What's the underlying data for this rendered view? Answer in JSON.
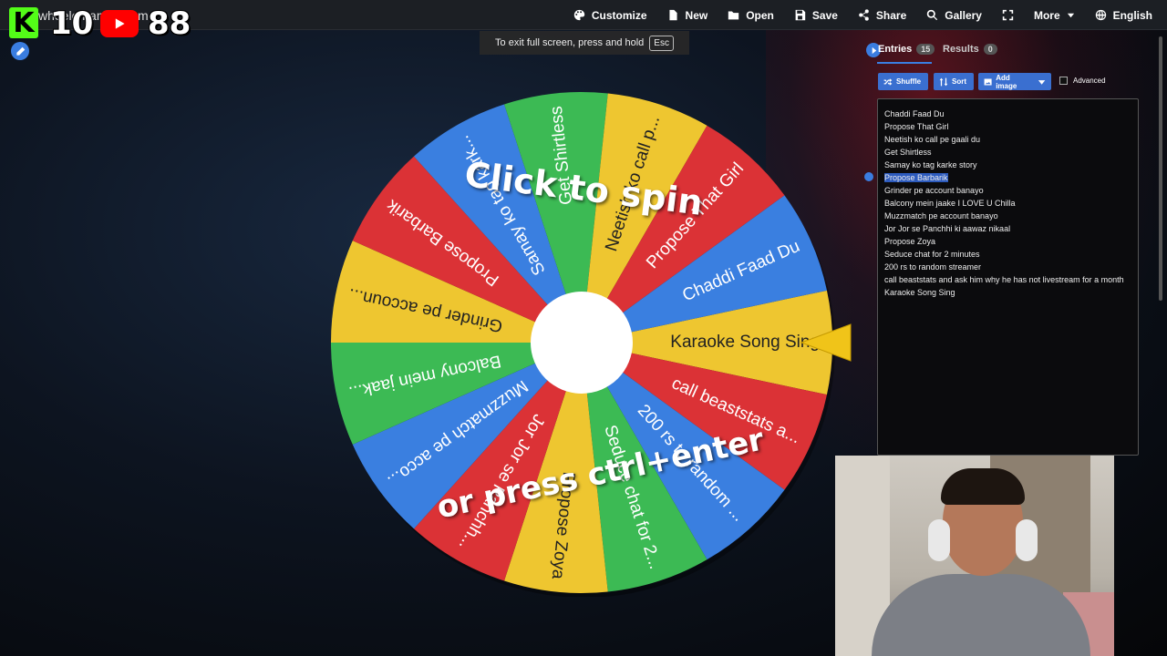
{
  "site_title": "wheelofnames.com",
  "overlay": {
    "left_number": "10",
    "right_number": "88",
    "icons": [
      "kick-logo",
      "youtube-logo",
      "pencil-icon"
    ]
  },
  "toolbar": {
    "items": [
      {
        "label": "Customize",
        "icon": "palette-icon"
      },
      {
        "label": "New",
        "icon": "file-icon"
      },
      {
        "label": "Open",
        "icon": "folder-icon"
      },
      {
        "label": "Save",
        "icon": "floppy-icon"
      },
      {
        "label": "Share",
        "icon": "share-icon"
      },
      {
        "label": "Gallery",
        "icon": "search-icon"
      },
      {
        "label": "",
        "icon": "fullscreen-icon"
      },
      {
        "label": "More",
        "icon": "caret-down-icon"
      },
      {
        "label": "English",
        "icon": "globe-icon"
      }
    ]
  },
  "fullscreen_notice": {
    "text": "To exit full screen, press and hold",
    "key": "Esc"
  },
  "wheel": {
    "spin_text_1": "Click to spin",
    "spin_text_2": "or press ctrl+enter",
    "colors": {
      "yellow": "#eec630",
      "red": "#db3236",
      "blue": "#3a7fe0",
      "green": "#3cba54"
    },
    "segments": [
      {
        "label": "Karaoke Song Sing",
        "color": "yellow"
      },
      {
        "label": "call beaststats a...",
        "color": "red"
      },
      {
        "label": "200 rs to random ...",
        "color": "blue"
      },
      {
        "label": "Seduce chat for 2...",
        "color": "green"
      },
      {
        "label": "Propose Zoya",
        "color": "yellow"
      },
      {
        "label": "Jor Jor se Panchh...",
        "color": "red"
      },
      {
        "label": "Muzzmatch pe acco...",
        "color": "blue"
      },
      {
        "label": "Balcony mein jaak...",
        "color": "green"
      },
      {
        "label": "Grinder pe accoun...",
        "color": "yellow"
      },
      {
        "label": "Propose Barbarik",
        "color": "red"
      },
      {
        "label": "Samay ko tag kark...",
        "color": "blue"
      },
      {
        "label": "Get Shirtless",
        "color": "green"
      },
      {
        "label": "Neetish ko call p...",
        "color": "yellow"
      },
      {
        "label": "Propose That Girl",
        "color": "red"
      },
      {
        "label": "Chaddi Faad Du",
        "color": "blue"
      }
    ]
  },
  "panel": {
    "tabs": [
      {
        "label": "Entries",
        "count": "15"
      },
      {
        "label": "Results",
        "count": "0"
      }
    ],
    "buttons": {
      "shuffle": "Shuffle",
      "sort": "Sort",
      "add_image": "Add image",
      "advanced": "Advanced"
    },
    "entries": [
      "Chaddi Faad Du",
      "Propose That Girl",
      "Neetish ko call pe gaali du",
      "Get Shirtless",
      "Samay ko tag karke story",
      "Propose Barbarik",
      "Grinder pe account banayo",
      "Balcony mein jaake I LOVE U Chilla",
      "Muzzmatch pe account banayo",
      "Jor Jor se Panchhi ki aawaz nikaal",
      "Propose Zoya",
      "Seduce chat for 2 minutes",
      "200 rs to random streamer",
      "call beaststats and ask him why he has not livestream for a month",
      "Karaoke Song Sing"
    ],
    "selected_index": 5
  }
}
